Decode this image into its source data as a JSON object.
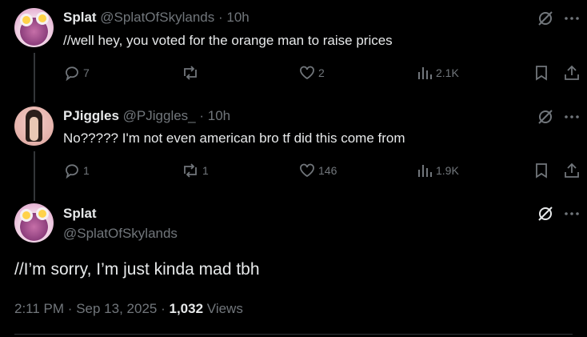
{
  "posts": [
    {
      "name": "Splat",
      "handle": "@SplatOfSkylands",
      "time": "10h",
      "text": "//well hey, you voted for the orange man to raise prices",
      "replies": "7",
      "reposts": "",
      "likes": "2",
      "views": "2.1K"
    },
    {
      "name": "PJiggles",
      "handle": "@PJiggles_",
      "time": "10h",
      "text": "No????? I'm not even american bro tf did this come from",
      "replies": "1",
      "reposts": "1",
      "likes": "146",
      "views": "1.9K"
    }
  ],
  "main_post": {
    "name": "Splat",
    "handle": "@SplatOfSkylands",
    "text": "//I’m sorry, I’m just kinda mad tbh",
    "time": "2:11 PM",
    "date": "Sep 13, 2025",
    "views_count": "1,032",
    "views_label": "Views",
    "separator": "·"
  },
  "icons": [
    "grok-icon",
    "more-icon",
    "reply-icon",
    "repost-icon",
    "like-icon",
    "views-icon",
    "bookmark-icon",
    "share-icon"
  ],
  "colors": {
    "background": "#000000",
    "text": "#e7e9ea",
    "muted": "#71767b"
  }
}
